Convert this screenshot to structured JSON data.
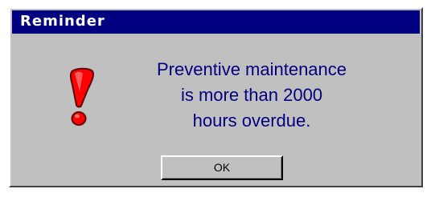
{
  "dialog": {
    "title": "Reminder",
    "icon": "exclamation-icon",
    "message_lines": [
      "Preventive maintenance",
      "is more than 2000",
      "hours overdue."
    ],
    "ok_label": "OK"
  },
  "colors": {
    "titlebar": "#000080",
    "face": "#c0c0c0",
    "message_text": "#000080",
    "icon_red": "#ff0000"
  }
}
